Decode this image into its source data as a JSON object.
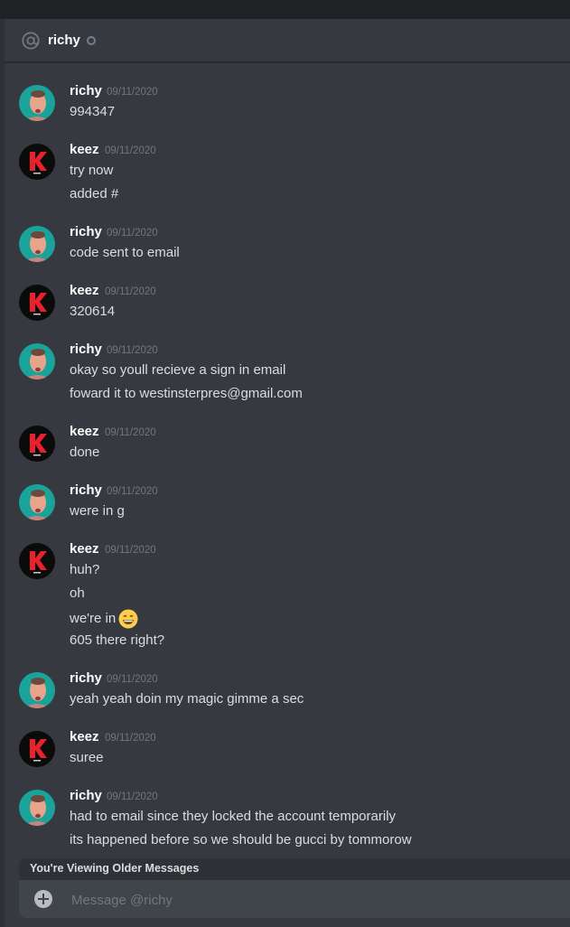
{
  "header": {
    "name": "richy",
    "icon": "at-icon",
    "status": "offline"
  },
  "messages": [
    {
      "author": "richy",
      "timestamp": "09/11/2020",
      "lines": [
        "994347"
      ]
    },
    {
      "author": "keez",
      "timestamp": "09/11/2020",
      "lines": [
        "try now",
        "added #"
      ]
    },
    {
      "author": "richy",
      "timestamp": "09/11/2020",
      "lines": [
        "code sent to email"
      ]
    },
    {
      "author": "keez",
      "timestamp": "09/11/2020",
      "lines": [
        "320614"
      ]
    },
    {
      "author": "richy",
      "timestamp": "09/11/2020",
      "lines": [
        "okay so youll recieve a sign in email",
        "foward it to westinsterpres@gmail.com"
      ]
    },
    {
      "author": "keez",
      "timestamp": "09/11/2020",
      "lines": [
        "done"
      ]
    },
    {
      "author": "richy",
      "timestamp": "09/11/2020",
      "lines": [
        "were in g"
      ]
    },
    {
      "author": "keez",
      "timestamp": "09/11/2020",
      "lines": [
        "huh?",
        "oh",
        "we're in",
        "605 there right?"
      ]
    },
    {
      "author": "richy",
      "timestamp": "09/11/2020",
      "lines": [
        "yeah yeah doin my magic gimme a sec"
      ]
    },
    {
      "author": "keez",
      "timestamp": "09/11/2020",
      "lines": [
        "suree"
      ]
    },
    {
      "author": "richy",
      "timestamp": "09/11/2020",
      "lines": [
        "had to email since they locked the account temporarily",
        "its happened before so we should be gucci by tommorow"
      ]
    }
  ],
  "emoji": "grinning-face-emoji",
  "older_banner": "You're Viewing Older Messages",
  "composer": {
    "placeholder": "Message @richy"
  },
  "colors": {
    "background": "#36393f",
    "accent_keez": "#e8212a",
    "avatar_richy_bg": "#1aa39a"
  }
}
